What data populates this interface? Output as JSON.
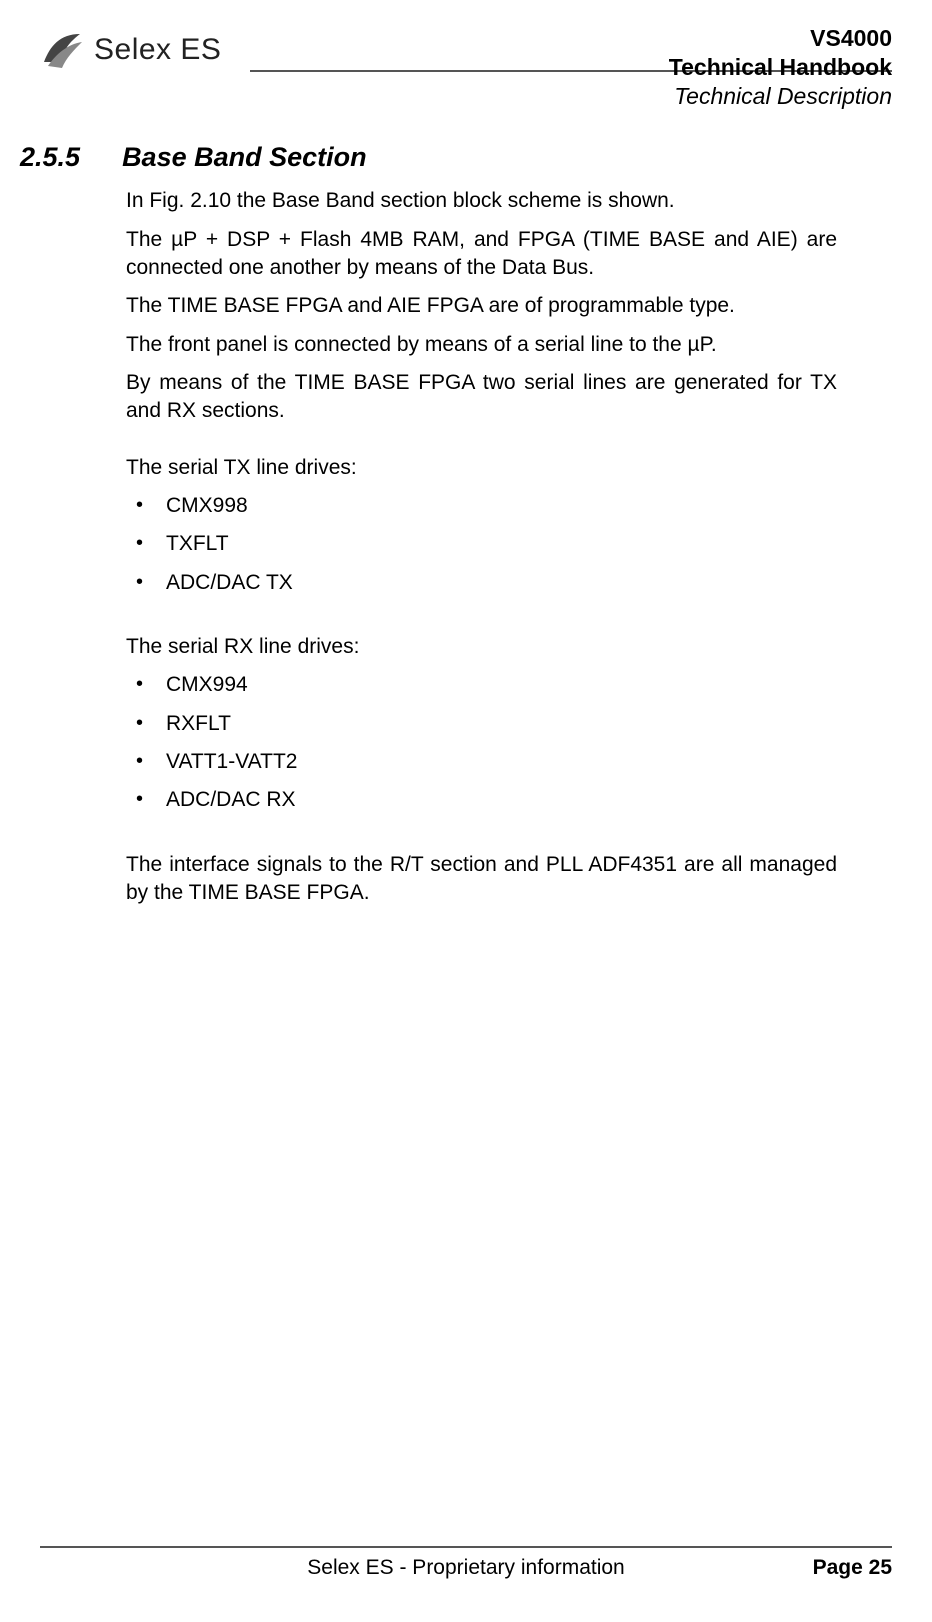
{
  "header": {
    "logo_text": "Selex ES",
    "product": "VS4000",
    "doc_title": "Technical Handbook",
    "doc_subtitle": "Technical Description"
  },
  "section": {
    "number": "2.5.5",
    "title": "Base Band Section"
  },
  "paragraphs": {
    "p1": "In Fig. 2.10 the Base Band section block scheme is shown.",
    "p2": "The µP + DSP +  Flash 4MB RAM, and FPGA (TIME BASE and AIE) are connected one another by means of the Data Bus.",
    "p3": "The TIME BASE FPGA and AIE FPGA are of programmable type.",
    "p4": "The front panel is connected by means of a serial line to the µP.",
    "p5": "By means of the TIME BASE FPGA two serial lines are generated for TX and RX sections.",
    "tx_intro": "The serial TX line drives:",
    "rx_intro": "The serial RX line drives:",
    "p_last": "The interface signals to the R/T section and PLL ADF4351 are all managed by the TIME BASE FPGA."
  },
  "tx_list": [
    "CMX998",
    "TXFLT",
    "ADC/DAC TX"
  ],
  "rx_list": [
    "CMX994",
    "RXFLT",
    "VATT1-VATT2",
    "ADC/DAC RX"
  ],
  "footer": {
    "center": "Selex ES - Proprietary information",
    "page_label": "Page 25"
  }
}
